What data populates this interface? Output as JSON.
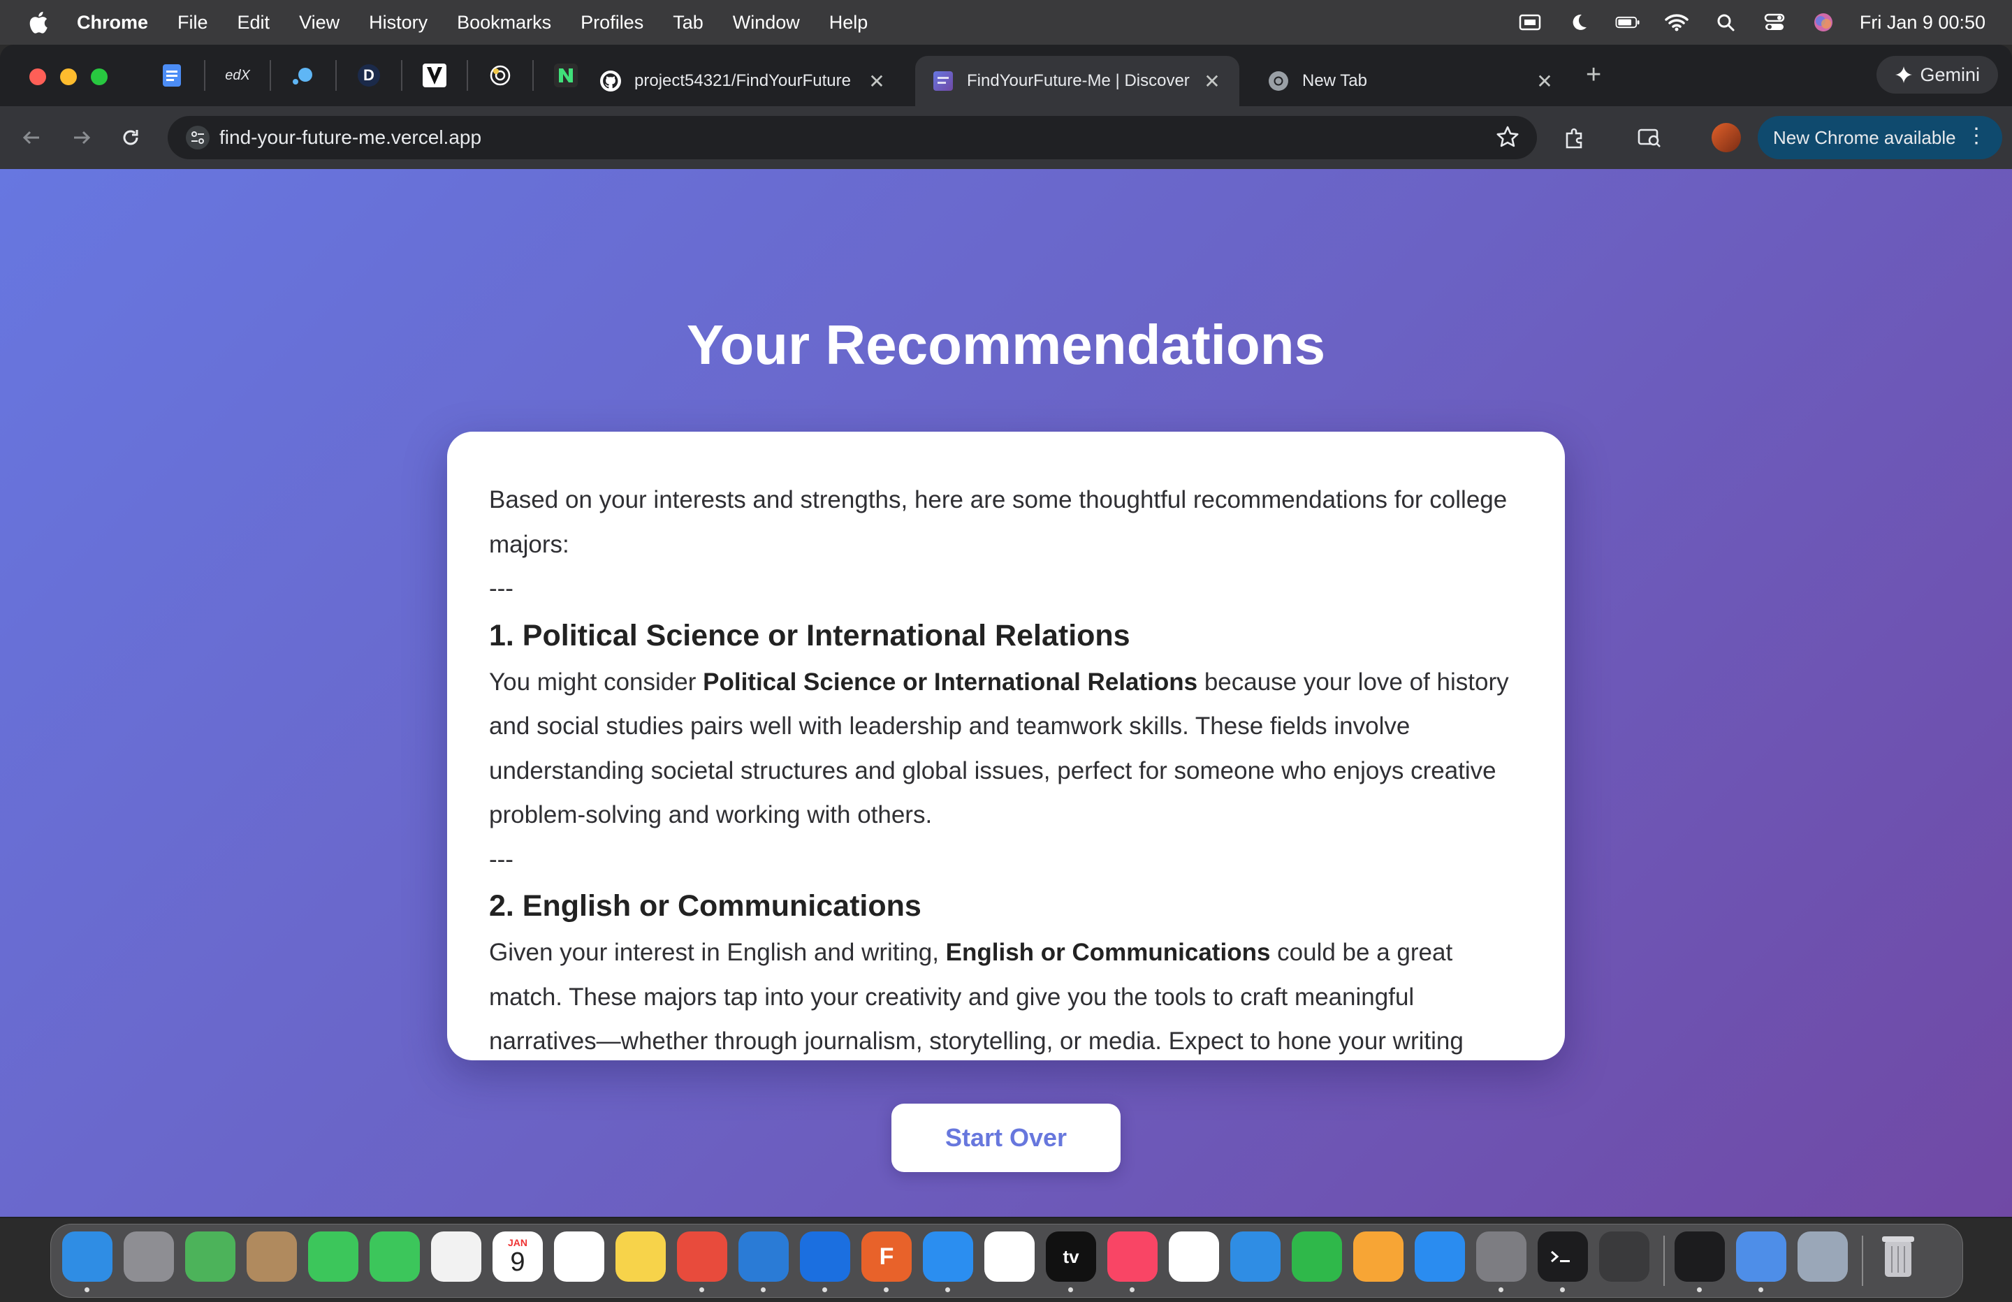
{
  "menubar": {
    "app_name": "Chrome",
    "items": [
      "File",
      "Edit",
      "View",
      "History",
      "Bookmarks",
      "Profiles",
      "Tab",
      "Window",
      "Help"
    ],
    "datetime": "Fri Jan 9  00:50"
  },
  "tabs": {
    "pinned": [
      "docs-icon",
      "edx-icon",
      "dot-icon",
      "d-icon",
      "v-icon",
      "openai-icon",
      "n-icon"
    ],
    "pinned_text": {
      "edx": "edX",
      "d": "D"
    },
    "items": [
      {
        "title": "project54321/FindYourFuture",
        "icon": "github-icon",
        "active": false
      },
      {
        "title": "FindYourFuture-Me | Discover",
        "icon": "site-icon",
        "active": true
      },
      {
        "title": "New Tab",
        "icon": "chrome-icon",
        "active": false
      }
    ],
    "new_tab": "+",
    "gemini_label": "Gemini"
  },
  "toolbar": {
    "url": "find-your-future-me.vercel.app",
    "new_chrome_label": "New Chrome available"
  },
  "page": {
    "heading": "Your Recommendations",
    "intro": "Based on your interests and strengths, here are some thoughtful recommendations for college majors:",
    "separator": "---",
    "sections": [
      {
        "title": "1. Political Science or International Relations",
        "prefix": "You might consider ",
        "bold": "Political Science or International Relations",
        "suffix": " because your love of history and social studies pairs well with leadership and teamwork skills. These fields involve understanding societal structures and global issues, perfect for someone who enjoys creative problem-solving and working with others."
      },
      {
        "title": "2. English or Communications",
        "prefix": "Given your interest in English and writing, ",
        "bold": "English or Communications",
        "suffix": " could be a great match. These majors tap into your creativity and give you the tools to craft meaningful narratives—whether through journalism, storytelling, or media. Expect to hone your writing"
      }
    ],
    "start_over": "Start Over"
  },
  "dock": {
    "apps": [
      {
        "name": "finder-icon",
        "color": "#2f8de4"
      },
      {
        "name": "launchpad-icon",
        "color": "#8e8e93"
      },
      {
        "name": "maps-icon",
        "color": "#4cb35a"
      },
      {
        "name": "contacts-icon",
        "color": "#b08a5e"
      },
      {
        "name": "facetime-icon",
        "color": "#3cc65b"
      },
      {
        "name": "messages-icon",
        "color": "#3cc65b"
      },
      {
        "name": "photos-icon",
        "color": "#f2f2f2"
      },
      {
        "name": "calendar-icon",
        "color": "#ffffff"
      },
      {
        "name": "reminders-icon",
        "color": "#ffffff"
      },
      {
        "name": "notes-icon",
        "color": "#f7d34a"
      },
      {
        "name": "chrome-icon",
        "color": "#e84b3c"
      },
      {
        "name": "vscode-icon",
        "color": "#2a7bd6"
      },
      {
        "name": "xcode-icon",
        "color": "#1b6fe0"
      },
      {
        "name": "fusion-icon",
        "color": "#e8622a"
      },
      {
        "name": "safari-icon",
        "color": "#2b8ef0"
      },
      {
        "name": "freeform-icon",
        "color": "#ffffff"
      },
      {
        "name": "apple-tv-icon",
        "color": "#111111"
      },
      {
        "name": "music-icon",
        "color": "#f94565"
      },
      {
        "name": "news-icon",
        "color": "#ffffff"
      },
      {
        "name": "keynote-icon",
        "color": "#2f8de4"
      },
      {
        "name": "numbers-icon",
        "color": "#2fb84a"
      },
      {
        "name": "pages-icon",
        "color": "#f7a535"
      },
      {
        "name": "app-store-icon",
        "color": "#2a8cf0"
      },
      {
        "name": "system-settings-icon",
        "color": "#7d7d82"
      },
      {
        "name": "terminal-icon",
        "color": "#1c1c1e"
      },
      {
        "name": "iphone-mirroring-icon",
        "color": "#3a3a3c"
      },
      {
        "name": "activity-monitor-icon",
        "color": "#1c1c1e"
      },
      {
        "name": "preview-icon",
        "color": "#4e8ee8"
      },
      {
        "name": "screenshot-preview-icon",
        "color": "#9aa7b8"
      },
      {
        "name": "trash-icon",
        "color": "#8e8e93"
      }
    ],
    "calendar_month": "JAN",
    "calendar_day": "9",
    "tv_label": "tv",
    "fusion_label": "F"
  }
}
